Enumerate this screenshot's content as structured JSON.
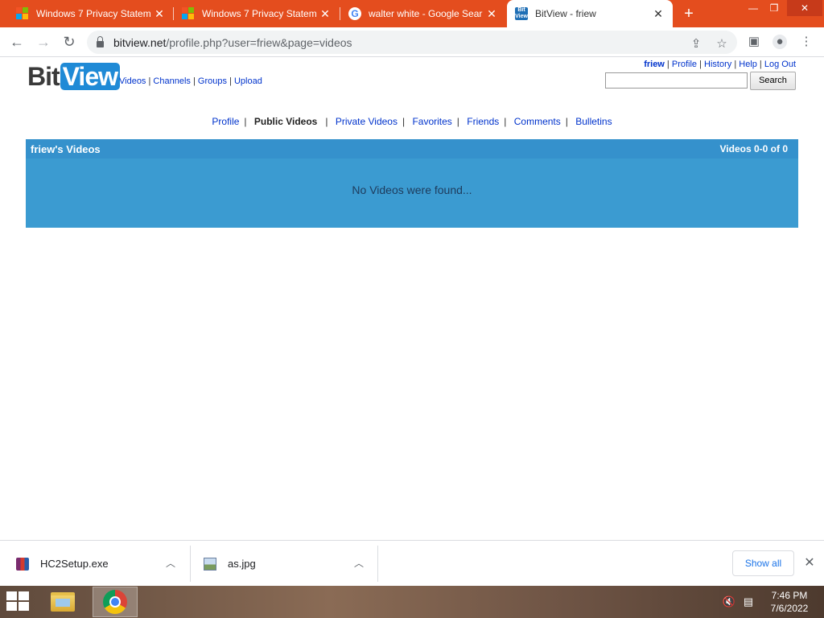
{
  "browser": {
    "tabs": [
      {
        "title": "Windows 7 Privacy Statem",
        "icon": "microsoft-icon"
      },
      {
        "title": "Windows 7 Privacy Statem",
        "icon": "microsoft-icon"
      },
      {
        "title": "walter white - Google Sear",
        "icon": "google-icon"
      },
      {
        "title": "BitView - friew",
        "icon": "bitview-icon",
        "active": true
      }
    ],
    "url_host": "bitview.net",
    "url_path": "/profile.php?user=friew&page=videos",
    "colors": {
      "tabstrip": "#e44d1e",
      "active_tab": "#ffffff"
    }
  },
  "site": {
    "logo_bit": "Bit",
    "logo_view": "View",
    "main_nav": [
      "Videos",
      "Channels",
      "Groups",
      "Upload"
    ],
    "user_nav": {
      "username": "friew",
      "links": [
        "Profile",
        "History",
        "Help",
        "Log Out"
      ]
    },
    "search": {
      "value": "",
      "button_label": "Search"
    }
  },
  "profile": {
    "tabs": [
      {
        "label": "Profile",
        "current": false
      },
      {
        "label": "Public Videos",
        "current": true
      },
      {
        "label": "Private Videos",
        "current": false
      },
      {
        "label": "Favorites",
        "current": false
      },
      {
        "label": "Friends",
        "current": false
      },
      {
        "label": "Comments",
        "current": false
      },
      {
        "label": "Bulletins",
        "current": false
      }
    ],
    "videos_title": "friew's Videos",
    "videos_count": "Videos 0-0 of 0",
    "empty_message": "No Videos were found...",
    "colors": {
      "panel": "#3b9bd1",
      "panel_header": "#3591cc",
      "link": "#0033cc"
    }
  },
  "downloads": {
    "items": [
      {
        "name": "HC2Setup.exe",
        "icon": "winrar-icon"
      },
      {
        "name": "as.jpg",
        "icon": "image-file-icon"
      }
    ],
    "show_all_label": "Show all"
  },
  "taskbar": {
    "apps": [
      {
        "name": "file-explorer-icon",
        "active": false
      },
      {
        "name": "chrome-icon",
        "active": true
      }
    ],
    "time": "7:46 PM",
    "date": "7/6/2022"
  }
}
